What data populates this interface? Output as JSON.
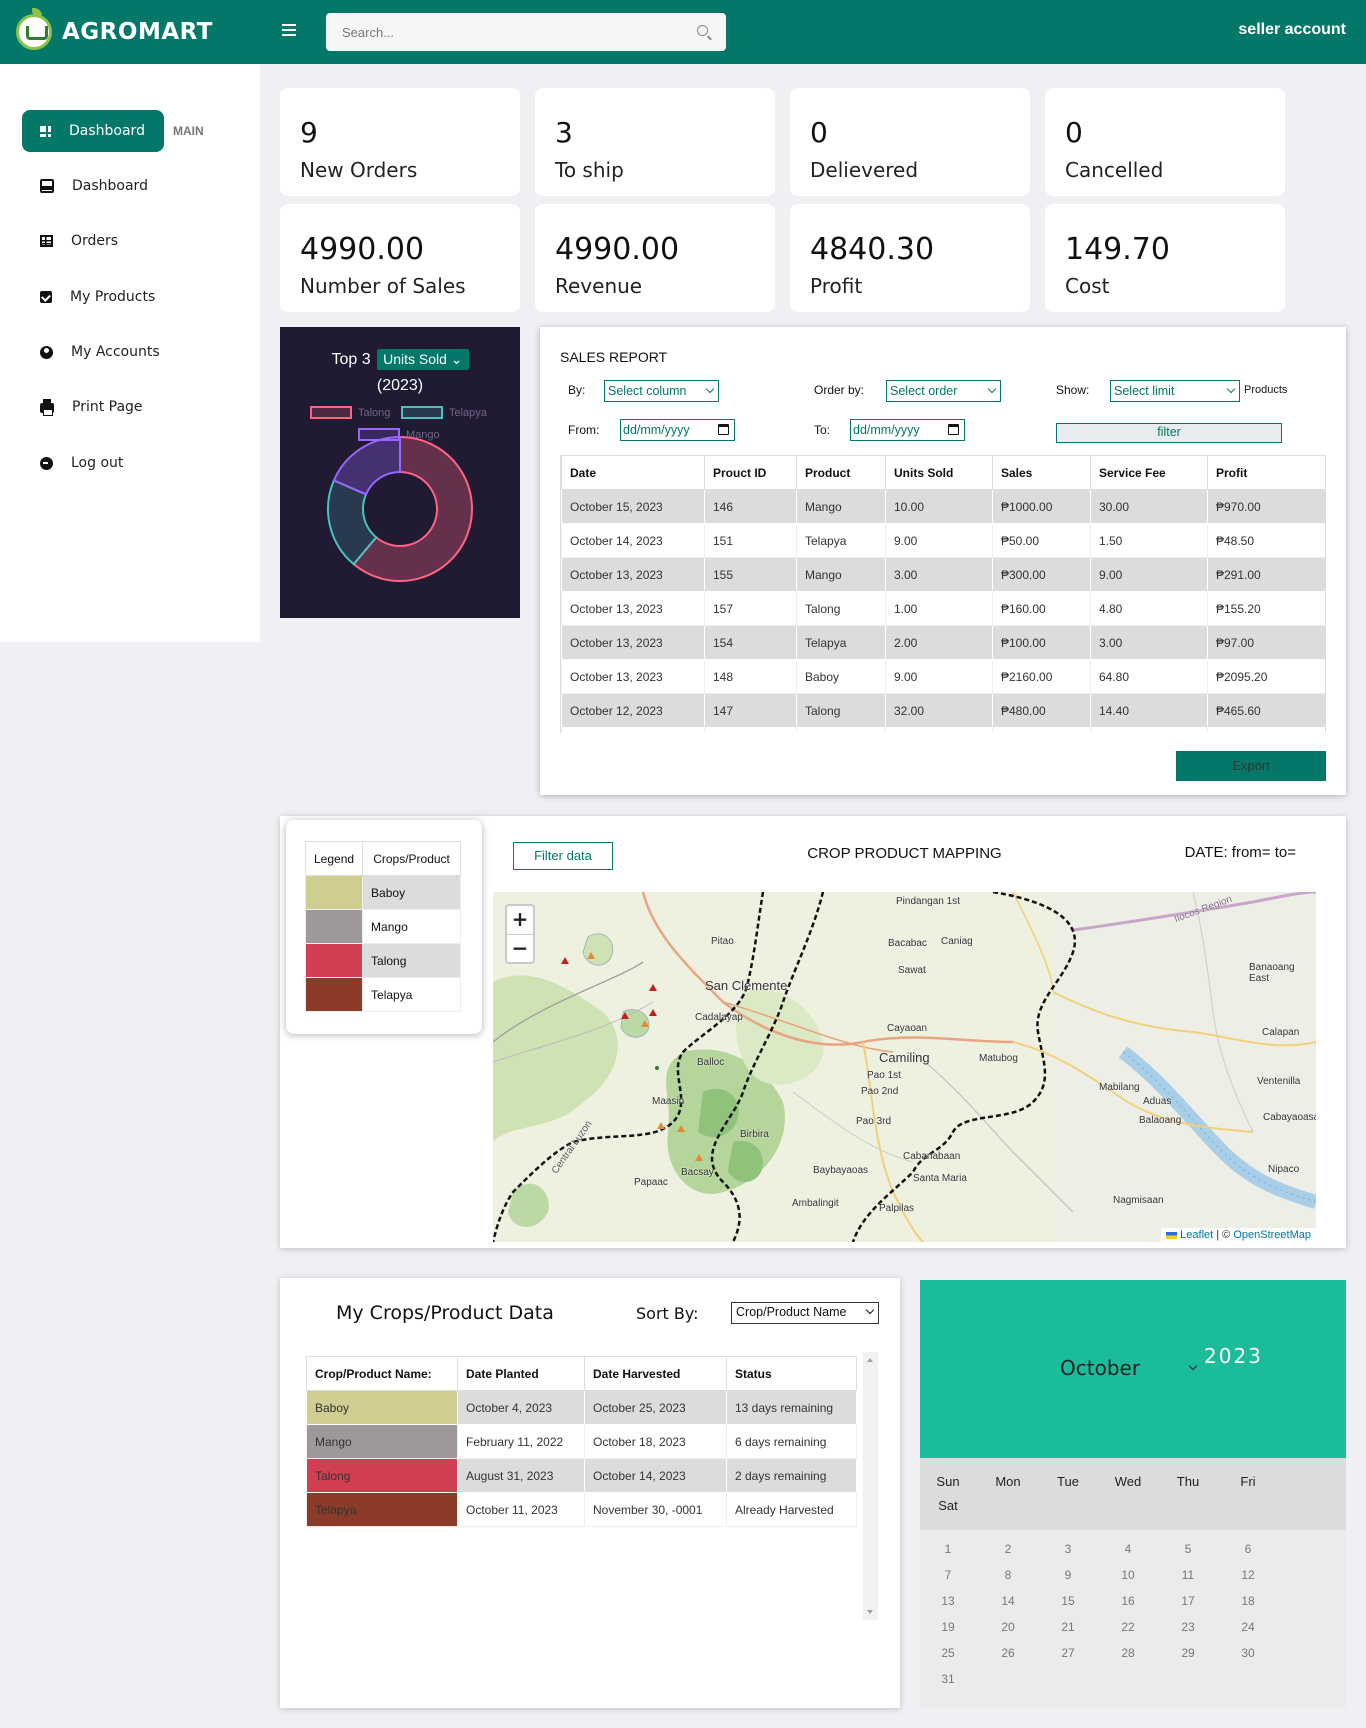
{
  "header": {
    "brand": "AGROMART",
    "search_placeholder": "Search...",
    "account": "seller account"
  },
  "sidebar": {
    "active": {
      "label": "Dashboard",
      "icon": "dashboard-grid-icon"
    },
    "section_label": "MAIN",
    "items": [
      {
        "label": "Dashboard",
        "icon": "inbox-icon"
      },
      {
        "label": "Orders",
        "icon": "table-icon"
      },
      {
        "label": "My Products",
        "icon": "chart-box-icon"
      },
      {
        "label": "My Accounts",
        "icon": "user-circle-icon"
      },
      {
        "label": "Print Page",
        "icon": "printer-icon"
      },
      {
        "label": "Log out",
        "icon": "logout-icon"
      }
    ]
  },
  "stats": [
    {
      "value": "9",
      "label": "New Orders"
    },
    {
      "value": "3",
      "label": "To ship"
    },
    {
      "value": "0",
      "label": "Delievered"
    },
    {
      "value": "0",
      "label": "Cancelled"
    },
    {
      "value": "4990.00",
      "label": "Number of Sales"
    },
    {
      "value": "4990.00",
      "label": "Revenue"
    },
    {
      "value": "4840.30",
      "label": "Profit"
    },
    {
      "value": "149.70",
      "label": "Cost"
    }
  ],
  "chart_data": {
    "type": "pie",
    "title": "Top 3",
    "metric": "Units Sold",
    "subtitle": "(2023)",
    "donut": true,
    "legend_position": "top",
    "categories": [
      "Talong",
      "Telapya",
      "Mango"
    ],
    "values": [
      33,
      11,
      10
    ],
    "colors": [
      "#ff6384",
      "#4bc0c0",
      "#9966ff"
    ]
  },
  "sales_report": {
    "title": "SALES REPORT",
    "by_label": "By:",
    "by_value": "Select column",
    "order_label": "Order by:",
    "order_value": "Select order",
    "show_label": "Show:",
    "show_value": "Select limit",
    "show_suffix": "Products",
    "from_label": "From:",
    "to_label": "To:",
    "date_placeholder": "dd/mm/yyyy",
    "filter_label": "filter",
    "export_label": "Export",
    "columns": [
      "Date",
      "Prouct ID",
      "Product",
      "Units Sold",
      "Sales",
      "Service Fee",
      "Profit"
    ],
    "rows": [
      [
        "October 15, 2023",
        "146",
        "Mango",
        "10.00",
        "₱1000.00",
        "30.00",
        "₱970.00"
      ],
      [
        "October 14, 2023",
        "151",
        "Telapya",
        "9.00",
        "₱50.00",
        "1.50",
        "₱48.50"
      ],
      [
        "October 13, 2023",
        "155",
        "Mango",
        "3.00",
        "₱300.00",
        "9.00",
        "₱291.00"
      ],
      [
        "October 13, 2023",
        "157",
        "Talong",
        "1.00",
        "₱160.00",
        "4.80",
        "₱155.20"
      ],
      [
        "October 13, 2023",
        "154",
        "Telapya",
        "2.00",
        "₱100.00",
        "3.00",
        "₱97.00"
      ],
      [
        "October 13, 2023",
        "148",
        "Baboy",
        "9.00",
        "₱2160.00",
        "64.80",
        "₱2095.20"
      ],
      [
        "October 12, 2023",
        "147",
        "Talong",
        "32.00",
        "₱480.00",
        "14.40",
        "₱465.60"
      ],
      [
        "",
        "",
        "",
        "",
        "",
        "",
        ""
      ]
    ]
  },
  "map": {
    "legend_headers": [
      "Legend",
      "Crops/Product"
    ],
    "legend_items": [
      {
        "name": "Baboy",
        "color": "#cfcd8f"
      },
      {
        "name": "Mango",
        "color": "#9e979c"
      },
      {
        "name": "Talong",
        "color": "#d23e52"
      },
      {
        "name": "Telapya",
        "color": "#8b3b28"
      }
    ],
    "filter_label": "Filter data",
    "title": "CROP PRODUCT MAPPING",
    "date_label": "DATE: from= to=",
    "zoom_in": "+",
    "zoom_out": "−",
    "attribution_leaflet": "Leaflet",
    "attribution_sep": " | © ",
    "attribution_osm": "OpenStreetMap",
    "towns": [
      "Pindangan 1st",
      "Pitao",
      "Bacabac",
      "Caniag",
      "Sawat",
      "San Clemente",
      "Cadalayap",
      "Cayaoan",
      "Camiling",
      "Matubog",
      "Balloc",
      "Pao 1st",
      "Pao 2nd",
      "Mabilang",
      "Aduas",
      "Balaoang",
      "Maasin",
      "Pao 3rd",
      "Birbira",
      "Cabanabaan",
      "Bacsay",
      "Papaac",
      "Baybayaoas",
      "Santa Maria",
      "Ambalingit",
      "Palpilas",
      "Nagmisaan",
      "Banaoang East",
      "Calapan",
      "Ventenilla",
      "Cabayaoasan",
      "Nipaco",
      "Ilocos Region",
      "Central Luzon"
    ]
  },
  "crops": {
    "title": "My Crops/Product Data",
    "sort_label": "Sort By:",
    "sort_value": "Crop/Product Name",
    "columns": [
      "Crop/Product Name:",
      "Date Planted",
      "Date Harvested",
      "Status"
    ],
    "rows": [
      {
        "name": "Baboy",
        "planted": "October 4, 2023",
        "harvested": "October 25, 2023",
        "status": "13 days remaining",
        "color": "#cfcd8f"
      },
      {
        "name": "Mango",
        "planted": "February 11, 2022",
        "harvested": "October 18, 2023",
        "status": "6 days remaining",
        "color": "#9e979c"
      },
      {
        "name": "Talong",
        "planted": "August 31, 2023",
        "harvested": "October 14, 2023",
        "status": "2 days remaining",
        "color": "#d23e52"
      },
      {
        "name": "Telapya",
        "planted": "October 11, 2023",
        "harvested": "November 30, -0001",
        "status": "Already Harvested",
        "color": "#8b3b28"
      }
    ]
  },
  "calendar": {
    "month": "October",
    "year": "2023",
    "day_names": [
      "Sun",
      "Mon",
      "Tue",
      "Wed",
      "Thu",
      "Fri",
      "Sat"
    ],
    "days": [
      "1",
      "2",
      "3",
      "4",
      "5",
      "6",
      "7",
      "8",
      "9",
      "10",
      "11",
      "12",
      "13",
      "14",
      "15",
      "16",
      "17",
      "18",
      "19",
      "20",
      "21",
      "22",
      "23",
      "24",
      "25",
      "26",
      "27",
      "28",
      "29",
      "30",
      "31"
    ]
  }
}
